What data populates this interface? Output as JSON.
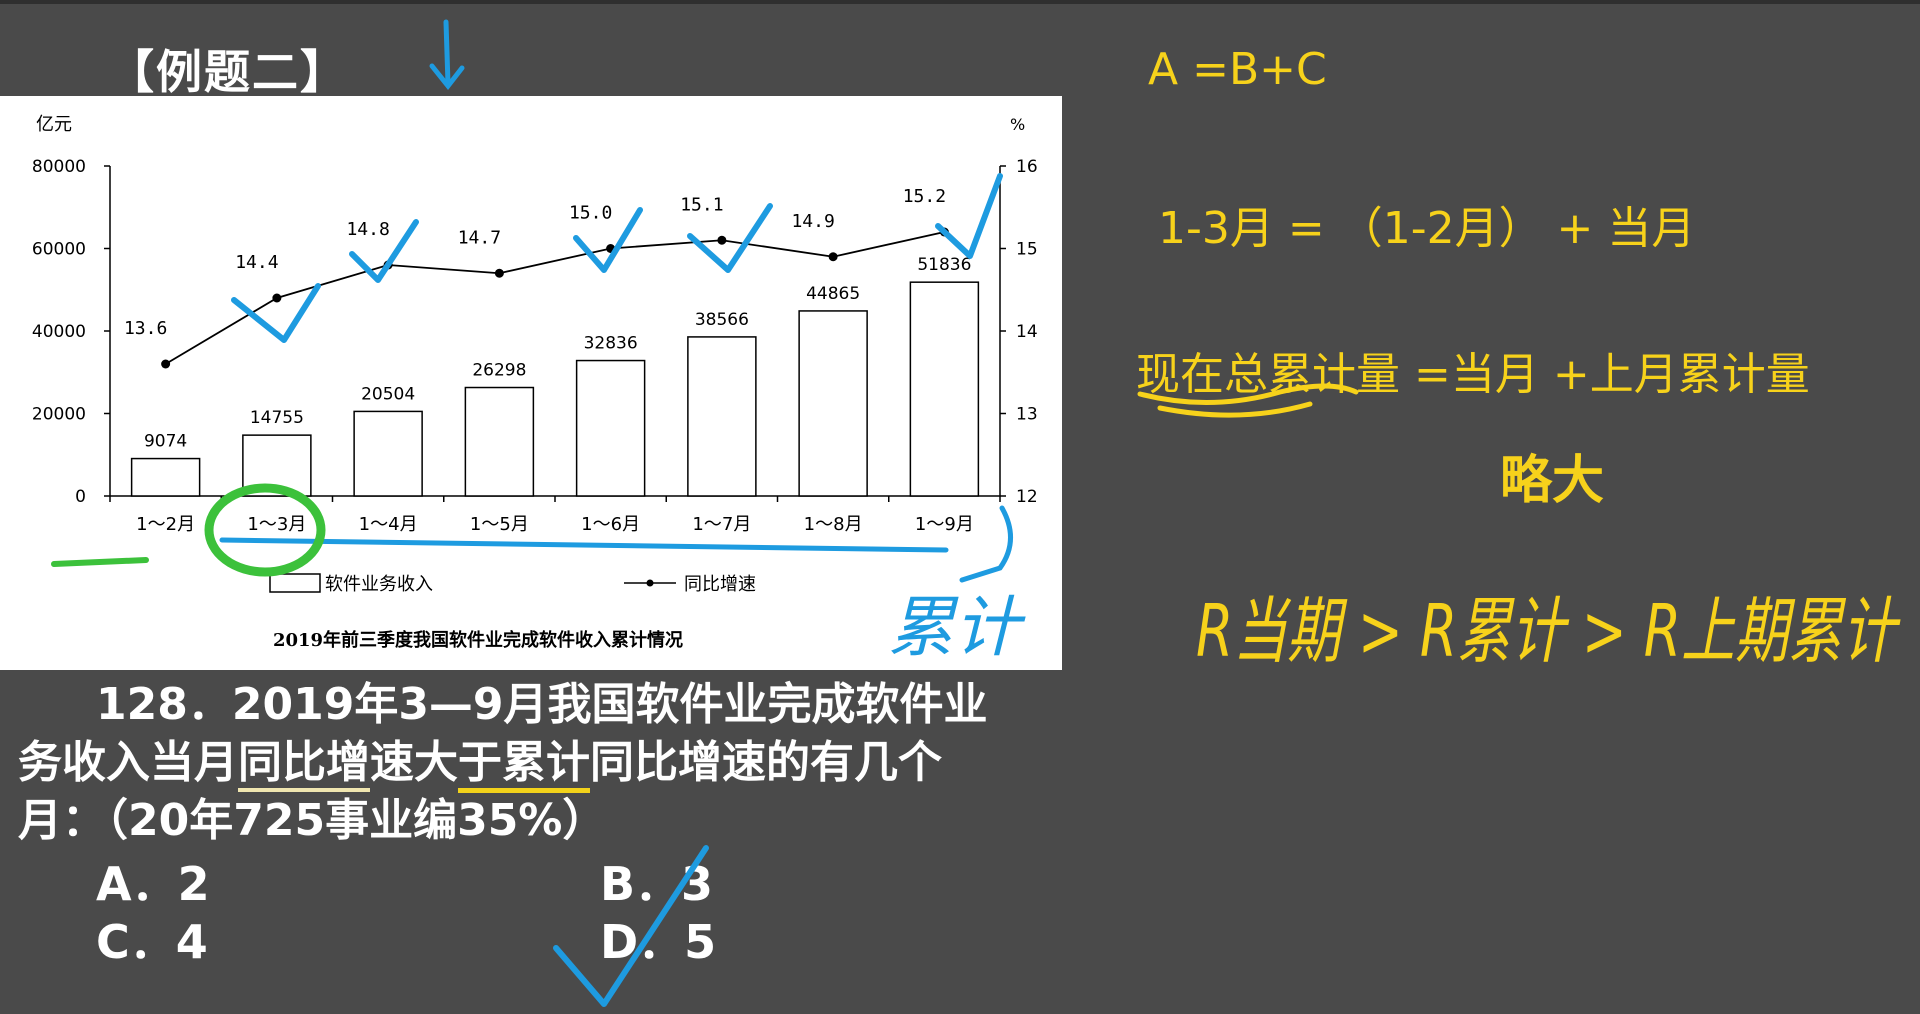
{
  "page": {
    "heading": "【例题二】"
  },
  "chart_data": {
    "type": "bar+line",
    "title": "2019年前三季度我国软件业完成软件收入累计情况",
    "left_axis_unit": "亿元",
    "right_axis_unit": "%",
    "left_ylim": [
      0,
      80000
    ],
    "left_ticks": [
      "0",
      "20000",
      "40000",
      "60000",
      "80000"
    ],
    "right_ylim": [
      12,
      16
    ],
    "right_ticks": [
      "12",
      "13",
      "14",
      "15",
      "16"
    ],
    "categories": [
      "1～2月",
      "1～3月",
      "1～4月",
      "1～5月",
      "1～6月",
      "1～7月",
      "1～8月",
      "1～9月"
    ],
    "series": [
      {
        "name": "软件业务收入",
        "kind": "bar",
        "axis": "left",
        "values": [
          9074,
          14755,
          20504,
          26298,
          32836,
          38566,
          44865,
          51836
        ],
        "labels": [
          "9074",
          "14755",
          "20504",
          "26298",
          "32836",
          "38566",
          "44865",
          "51836"
        ]
      },
      {
        "name": "同比增速",
        "kind": "line",
        "axis": "right",
        "values": [
          13.6,
          14.4,
          14.8,
          14.7,
          15.0,
          15.1,
          14.9,
          15.2
        ],
        "labels": [
          "13.6",
          "14.4",
          "14.8",
          "14.7",
          "15.0",
          "15.1",
          "14.9",
          "15.2"
        ]
      }
    ],
    "grid": false,
    "legend_position": "bottom"
  },
  "question": {
    "number": "128．",
    "text_a": "2019年3—9月我国软件业完成软件业",
    "text_b": "务收入当月",
    "text_u1": "同比增",
    "text_c": "速大",
    "text_u2": "于累计",
    "text_d": "同比增速的有几个",
    "text_e": "月：（20年725事业编35%）",
    "options": [
      "A．2",
      "B．3",
      "C．4",
      "D．5"
    ]
  },
  "notes": {
    "line1": "A =B+C",
    "line2": "1-3月 = （1-2月） + 当月",
    "line3_u": "现在总累计量",
    "line3_rest": " =当月 +上月累计量"
  },
  "handwriting": {
    "left_word": "累计",
    "top_word": "略大",
    "right_expr": "R当期 > R累计 > R上期累计"
  },
  "colors": {
    "background": "#4a4a4a",
    "annotation_yellow": "#f7d21b",
    "annotation_blue": "#1e9be0",
    "annotation_green": "#3cc13b"
  }
}
